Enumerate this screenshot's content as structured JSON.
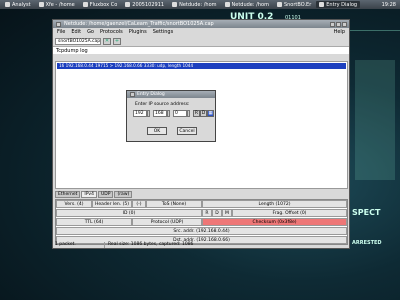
{
  "taskbar": {
    "items": [
      {
        "label": "Analyst"
      },
      {
        "label": "Xfe - /home"
      },
      {
        "label": "Fluxbox Co"
      },
      {
        "label": "2005102911"
      },
      {
        "label": "Netdude: /hom"
      },
      {
        "label": "Netdude: /hom"
      },
      {
        "label": "SnortBO.Er"
      },
      {
        "label": "Entry Dialog"
      }
    ],
    "clock": "19:28"
  },
  "window": {
    "title": "Netdude: /home/gaenzel/CaLeam_Traffic/snortBO1025A.cap",
    "menu": [
      "File",
      "Edit",
      "Go",
      "Protocols",
      "Plugins",
      "Settings"
    ],
    "help": "Help",
    "file_tab": "snortBO1025A.cap",
    "log_label": "Tcpdump log",
    "log_row": "16 192.168.0.44 19715 > 192.168.0.66 3330: udp, length 1044",
    "tabs": [
      "Ethernet",
      "IPv4",
      "UDP",
      "(raw)"
    ],
    "fields": {
      "vers": "Vers. (4)",
      "hlen": "Header len. (5)",
      "minus": "(-)",
      "tos": "ToS (None)",
      "length": "Length (1072)",
      "id": "ID (0)",
      "r": "R",
      "d": "D",
      "m": "M",
      "frag": "Frag. Offset (0)",
      "ttl": "TTL (64)",
      "proto": "Protocol (UDP)",
      "checksum": "Checksum (0x3f8e)",
      "src": "Src. addr. (192.168.0.44)",
      "dst": "Dst. addr. (192.168.0.66)"
    },
    "status_left": "1 packet.",
    "status_right": "Real size: 1086 bytes, captured: 1086"
  },
  "dialog": {
    "title": "Entry Dialog",
    "label": "Enter IP source address:",
    "octets": [
      "192",
      "168",
      "0",
      "44"
    ],
    "modes": [
      "R",
      "D"
    ],
    "ok": "OK",
    "cancel": "Cancel"
  },
  "wallpaper": {
    "unit": "UNIT 0.2",
    "unit_sub": "01101",
    "spect": "SPECT",
    "arrested": "ARRESTED",
    "side_text": "Uptime 1h 6m"
  }
}
